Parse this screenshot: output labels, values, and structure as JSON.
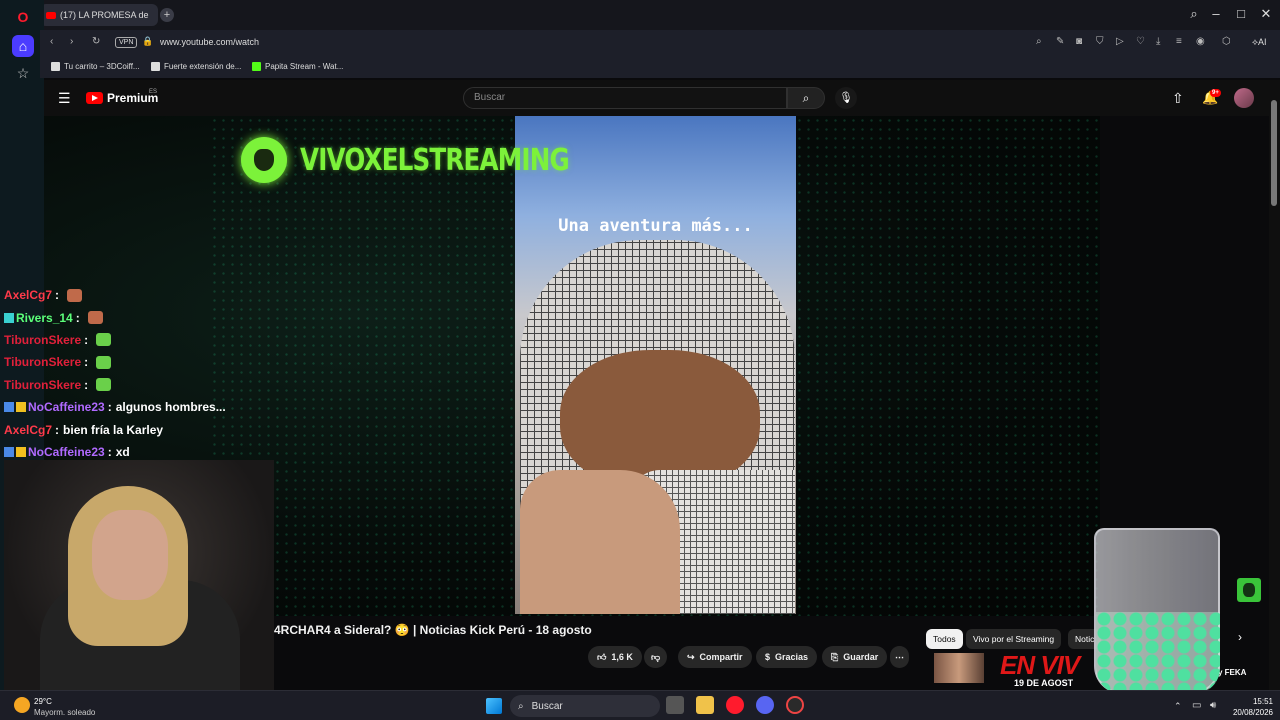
{
  "browser": {
    "tab_title": "(17) LA PROMESA de",
    "url": "www.youtube.com/watch",
    "vpn_label": "VPN",
    "ai_label": "AI",
    "bookmarks": [
      "Tu carrito – 3DCoiff...",
      "Fuerte extensión de...",
      "Papita Stream - Wat..."
    ]
  },
  "youtube": {
    "logo": "Premium",
    "region": "ES",
    "search_placeholder": "Buscar",
    "notifications": "9+",
    "video_title": "4RCHAR4 a Sideral? 😳 | Noticias Kick Perú - 18 agosto",
    "actions": {
      "likes": "1,6 K",
      "share": "Compartir",
      "thanks": "Gracias",
      "save": "Guardar"
    },
    "chips": [
      "Todos",
      "Vivo por el Streaming",
      "Notic"
    ],
    "thumb_text": "EN VIV",
    "thumb_subtext": "19 DE AGOST",
    "thumb_feka": "y FEKA"
  },
  "overlay": {
    "brand": "VIVOXELSTREAMING",
    "caption": "Una aventura más...",
    "chat": [
      {
        "user": "AxelCg7",
        "color": "#ff3a4a",
        "text": "",
        "emote": "#c06a4a"
      },
      {
        "user": "Rivers_14",
        "color": "#5cff7a",
        "text": "",
        "emote": "#c06a4a"
      },
      {
        "user": "TiburonSkere",
        "color": "#e0203a",
        "text": "",
        "emote": "#6ad04a"
      },
      {
        "user": "TiburonSkere",
        "color": "#e0203a",
        "text": "",
        "emote": "#6ad04a"
      },
      {
        "user": "TiburonSkere",
        "color": "#e0203a",
        "text": "",
        "emote": "#6ad04a"
      },
      {
        "user": "NoCaffeine23",
        "color": "#b06aff",
        "text": "algunos hombres...",
        "emote": ""
      },
      {
        "user": "AxelCg7",
        "color": "#ff3a4a",
        "text": "bien fría la Karley",
        "emote": ""
      },
      {
        "user": "NoCaffeine23",
        "color": "#b06aff",
        "text": "xd",
        "emote": ""
      }
    ]
  },
  "taskbar": {
    "weather_temp": "29°C",
    "weather_desc": "Mayorm. soleado",
    "search": "Buscar",
    "time": "15:51",
    "date": "20/08/2026"
  }
}
